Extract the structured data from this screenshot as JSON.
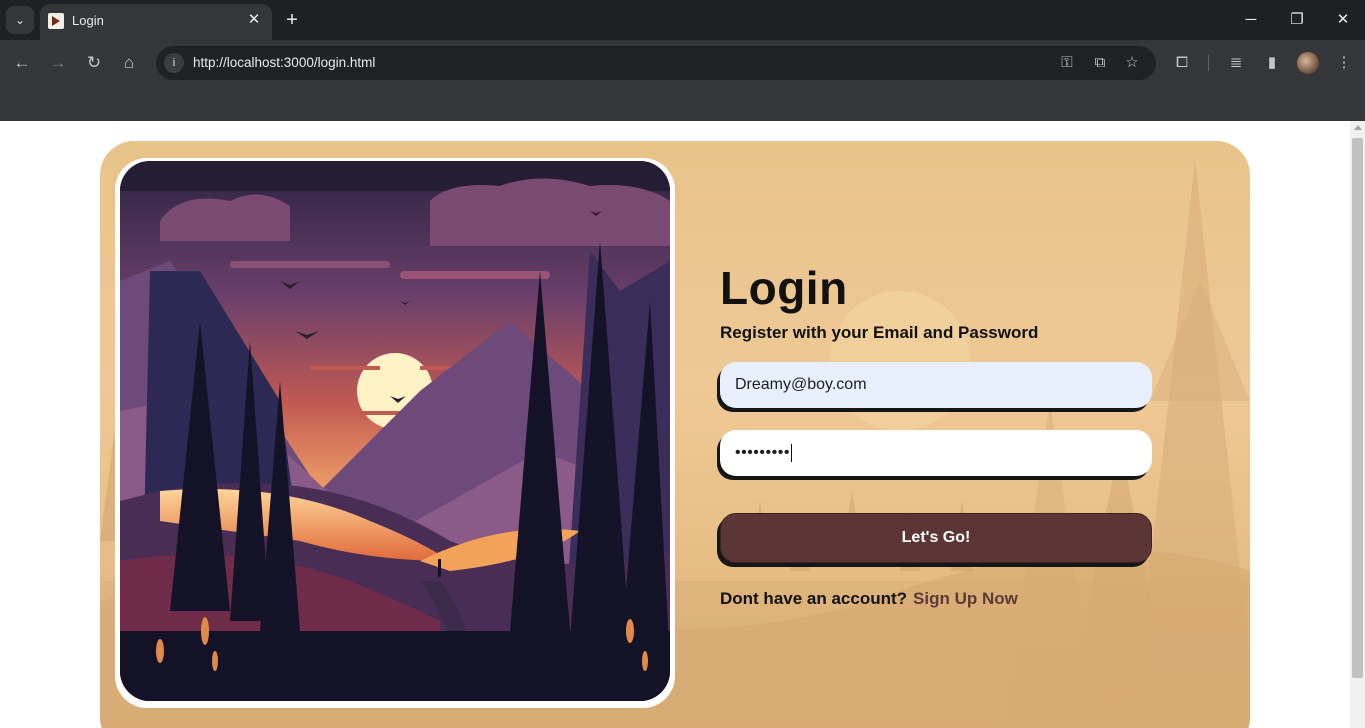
{
  "browser": {
    "tab_title": "Login",
    "url": "http://localhost:3000/login.html",
    "new_tab_glyph": "+",
    "close_glyph": "✕"
  },
  "page": {
    "title": "Login",
    "subtitle": "Register with your Email and Password",
    "email_value": "Dreamy@boy.com",
    "password_masked": "•••••••••",
    "submit_label": "Let's Go!",
    "signup_prompt": "Dont have an account?",
    "signup_link": "Sign Up Now"
  },
  "icons": {
    "tab_switcher": "chevron-down-icon",
    "back": "arrow-left-icon",
    "forward": "arrow-right-icon",
    "reload": "reload-icon",
    "home": "home-icon",
    "site_info": "info-icon",
    "password_key": "key-icon",
    "open_in_app": "open-external-icon",
    "bookmark": "star-icon",
    "extensions": "puzzle-icon",
    "media": "media-queue-icon",
    "side_panel": "side-panel-icon",
    "menu": "kebab-menu-icon"
  },
  "colors": {
    "card_background": "#e8c38a",
    "button": "#5c3636",
    "signup_link": "#5c3a36",
    "email_autofill": "#e8f0fe"
  }
}
